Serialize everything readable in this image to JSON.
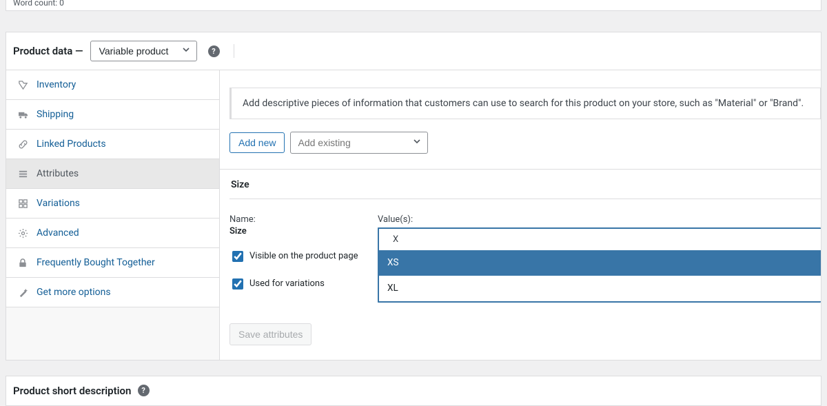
{
  "topbar": {
    "word_count": "Word count: 0"
  },
  "header": {
    "label": "Product data —",
    "product_type": "Variable product"
  },
  "tabs": [
    {
      "key": "inventory",
      "label": "Inventory",
      "icon": "inventory"
    },
    {
      "key": "shipping",
      "label": "Shipping",
      "icon": "truck"
    },
    {
      "key": "linked",
      "label": "Linked Products",
      "icon": "link"
    },
    {
      "key": "attributes",
      "label": "Attributes",
      "icon": "list",
      "active": true
    },
    {
      "key": "variations",
      "label": "Variations",
      "icon": "grid"
    },
    {
      "key": "advanced",
      "label": "Advanced",
      "icon": "gear"
    },
    {
      "key": "fbt",
      "label": "Frequently Bought Together",
      "icon": "lock"
    },
    {
      "key": "more",
      "label": "Get more options",
      "icon": "wand"
    }
  ],
  "content": {
    "info": "Add descriptive pieces of information that customers can use to search for this product on your store, such as \"Material\" or \"Brand\".",
    "add_new_label": "Add new",
    "add_existing_placeholder": "Add existing",
    "attribute": {
      "title": "Size",
      "name_label": "Name:",
      "name_value": "Size",
      "visible_label": "Visible on the product page",
      "visible_checked": true,
      "used_variations_label": "Used for variations",
      "used_variations_checked": true,
      "values_label": "Value(s):",
      "search_text": "X",
      "options": [
        {
          "label": "XS",
          "highlighted": true
        },
        {
          "label": "XL",
          "highlighted": false
        }
      ]
    },
    "save_label": "Save attributes"
  },
  "short_desc": {
    "title": "Product short description"
  }
}
